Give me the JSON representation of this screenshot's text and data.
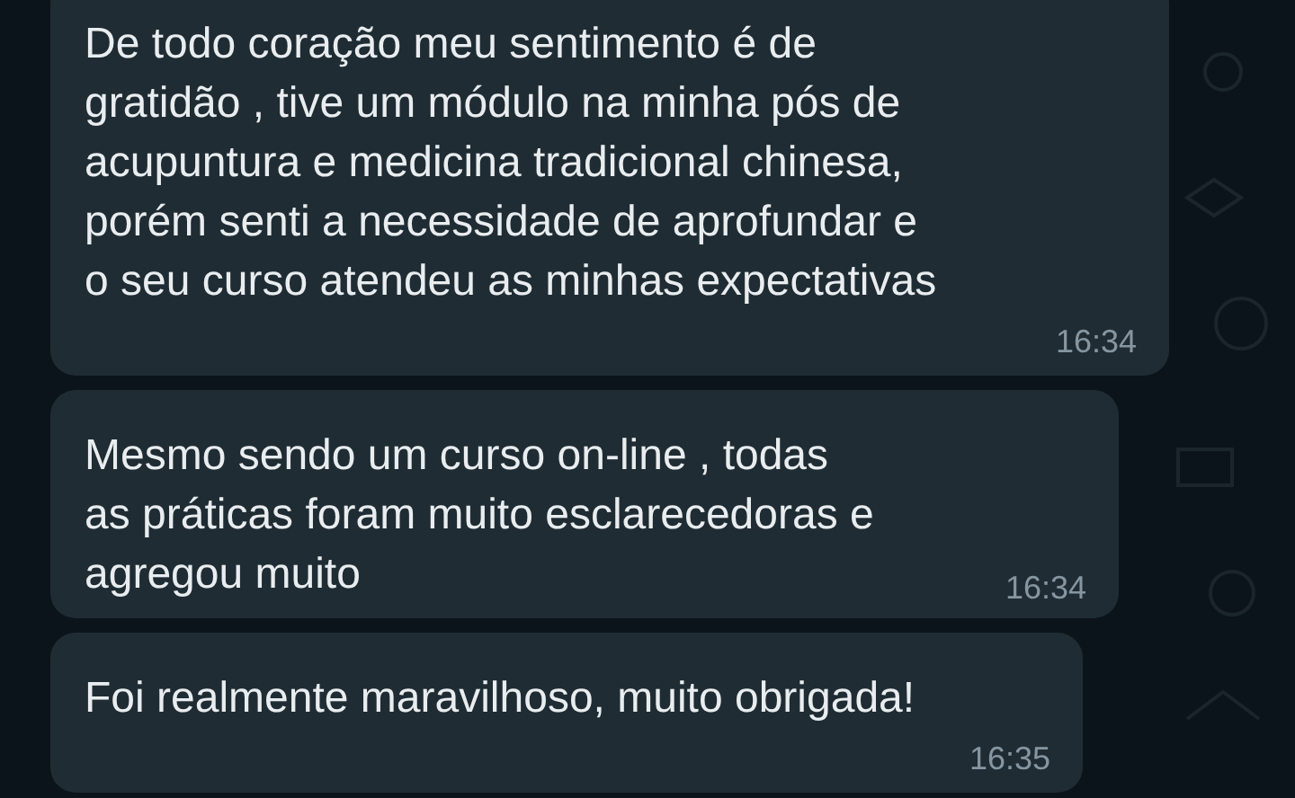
{
  "messages": [
    {
      "text": "De todo coração meu sentimento é de\ngratidão , tive um módulo na minha pós de\nacupuntura e medicina tradicional chinesa,\nporém senti a necessidade de aprofundar e\no seu curso atendeu as minhas expectativas",
      "time": "16:34"
    },
    {
      "text": "Mesmo sendo um curso on-line , todas\nas práticas foram muito esclarecedoras e\nagregou muito",
      "time": "16:34"
    },
    {
      "text": "Foi realmente maravilhoso, muito obrigada!",
      "time": "16:35"
    }
  ]
}
